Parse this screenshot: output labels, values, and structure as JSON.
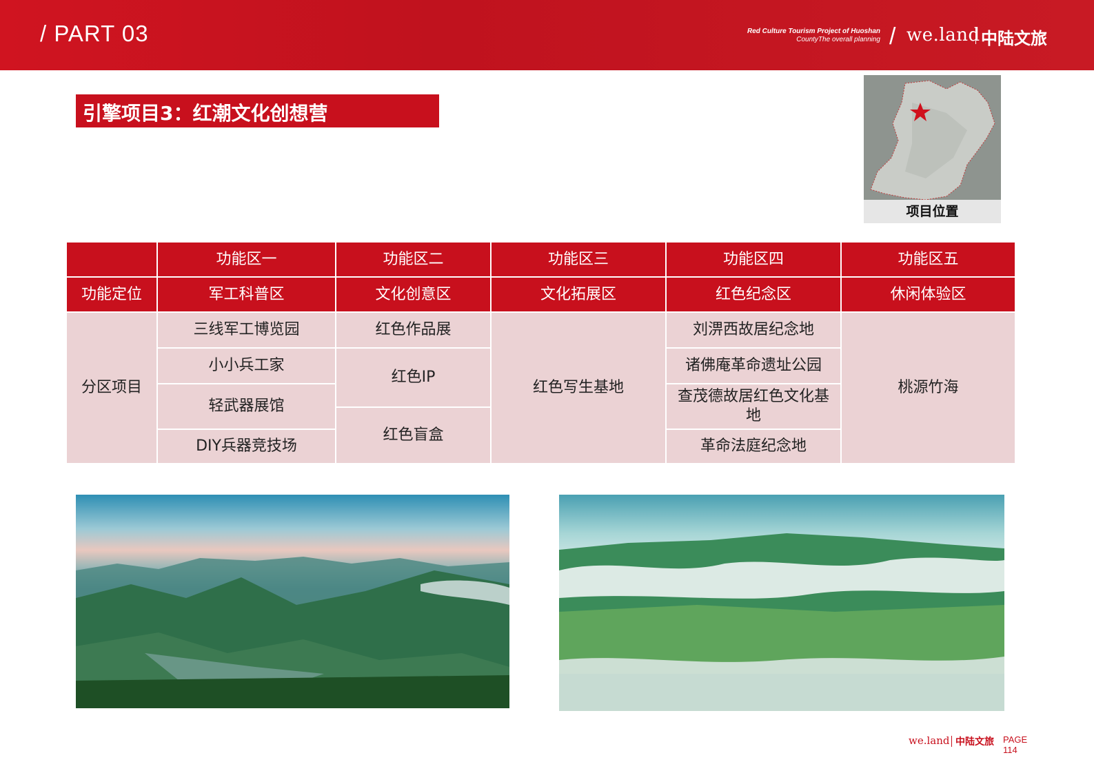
{
  "header": {
    "part": "/ PART 03",
    "subtitle_line1": "Red Culture Tourism Project of Huoshan",
    "subtitle_line2": "CountyThe overall planning",
    "slash": "/",
    "brand_en": "we.land",
    "brand_cn": "中陆文旅"
  },
  "title": "引擎项目3：红潮文化创想营",
  "map": {
    "caption": "项目位置",
    "marker_icon": "star-icon",
    "marker_color": "#d0101c"
  },
  "table": {
    "headers": [
      "功能区一",
      "功能区二",
      "功能区三",
      "功能区四",
      "功能区五"
    ],
    "positioning_label": "功能定位",
    "positioning": [
      "军工科普区",
      "文化创意区",
      "文化拓展区",
      "红色纪念区",
      "休闲体验区"
    ],
    "projects_label": "分区项目",
    "zone1": [
      "三线军工博览园",
      "小小兵工家",
      "轻武器展馆",
      "DIY兵器竞技场"
    ],
    "zone2": [
      "红色作品展",
      "红色IP",
      "红色盲盒"
    ],
    "zone3": [
      "红色写生基地"
    ],
    "zone4": [
      "刘淠西故居纪念地",
      "诸佛庵革命遗址公园",
      "查茂德故居红色文化基地",
      "革命法庭纪念地"
    ],
    "zone5": [
      "桃源竹海"
    ]
  },
  "footer": {
    "brand_en": "we.land",
    "brand_cn": "中陆文旅",
    "page_label": "PAGE",
    "page_number": "114"
  },
  "colors": {
    "accent": "#c8101d",
    "table_body": "#ebd2d4"
  }
}
